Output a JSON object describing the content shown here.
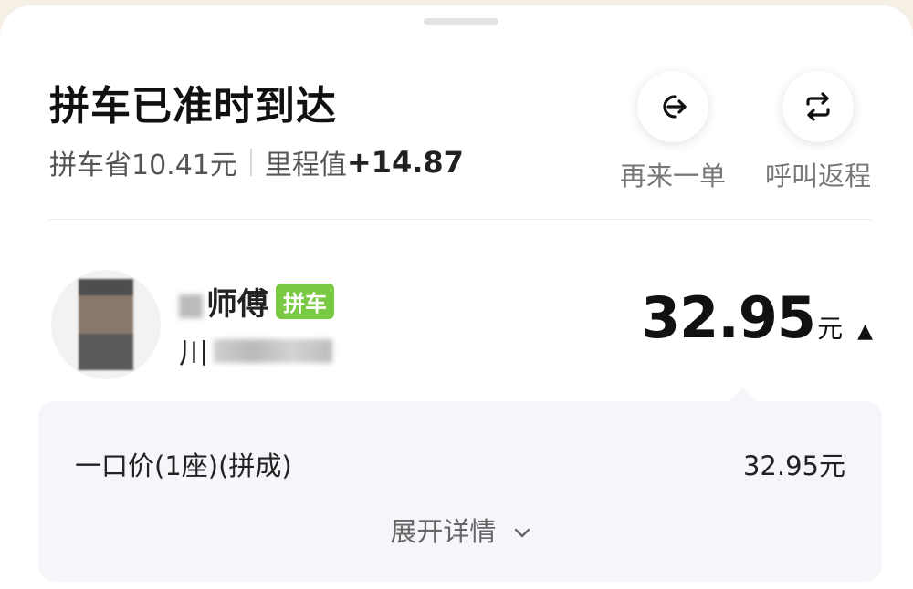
{
  "header": {
    "title": "拼车已准时到达",
    "savings_text": "拼车省10.41元",
    "mileage_label": "里程值",
    "mileage_value": "+14.87"
  },
  "actions": [
    {
      "label": "再来一单",
      "icon": "login-arrow-icon"
    },
    {
      "label": "呼叫返程",
      "icon": "repeat-icon"
    }
  ],
  "driver": {
    "name_suffix": "师傅",
    "badge": "拼车",
    "plate_prefix": "川"
  },
  "price": {
    "amount": "32.95",
    "unit": "元",
    "caret": "▲"
  },
  "fare": {
    "label": "一口价(1座)(拼成)",
    "value": "32.95元",
    "expand_label": "展开详情"
  },
  "colors": {
    "badge_green": "#7ac943",
    "panel_bg": "#f4f6fa",
    "page_bg": "#f6efe6"
  }
}
